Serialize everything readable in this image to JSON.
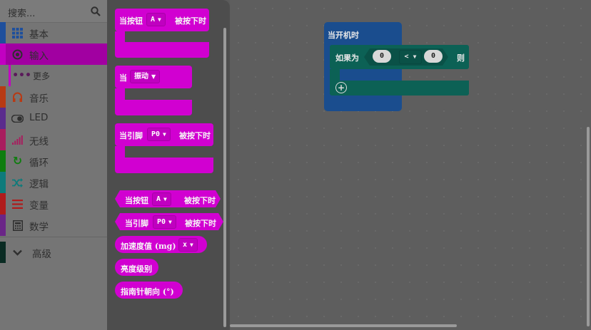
{
  "colors": {
    "basic": "#1e4f9c",
    "input": "#c200c2",
    "music": "#b83a14",
    "led": "#5a2b8d",
    "radio": "#a81d5e",
    "loops": "#0f7d0f",
    "logic": "#0e7b7b",
    "variables": "#b01c1c",
    "math": "#6a2587",
    "advanced": "#0a2b23",
    "flyout_block": "#d100d1",
    "logic_block": "#0c6155"
  },
  "search": {
    "placeholder": "搜索..."
  },
  "categories": [
    {
      "label": "基本",
      "icon": "grid-icon"
    },
    {
      "label": "输入",
      "icon": "radio-circle-icon"
    },
    {
      "label": "更多",
      "icon": "more-dots-icon"
    },
    {
      "label": "音乐",
      "icon": "headphones-icon"
    },
    {
      "label": "LED",
      "icon": "toggle-icon"
    },
    {
      "label": "无线",
      "icon": "signal-bars-icon"
    },
    {
      "label": "循环",
      "icon": "refresh-icon"
    },
    {
      "label": "逻辑",
      "icon": "shuffle-icon"
    },
    {
      "label": "变量",
      "icon": "list-lines-icon"
    },
    {
      "label": "数学",
      "icon": "calculator-icon"
    },
    {
      "label": "高级",
      "icon": "chevron-down-icon"
    }
  ],
  "flyout": {
    "on_button": {
      "prefix": "当按钮",
      "value": "A",
      "suffix": "被按下时"
    },
    "on_gesture": {
      "prefix": "当",
      "value": "振动"
    },
    "on_pin": {
      "prefix": "当引脚",
      "value": "P0",
      "suffix": "被按下时"
    },
    "button_pressed": {
      "prefix": "当按钮",
      "value": "A",
      "suffix": "被按下时"
    },
    "pin_pressed": {
      "prefix": "当引脚",
      "value": "P0",
      "suffix": "被按下时"
    },
    "acceleration": {
      "label": "加速度值 (mg)",
      "value": "x"
    },
    "light_level": {
      "label": "亮度级别"
    },
    "compass": {
      "label": "指南针朝向 (°)"
    }
  },
  "workspace": {
    "start_label": "当开机时",
    "if_label": "如果为",
    "left_value": "0",
    "operator": "<",
    "right_value": "0",
    "then_label": "则"
  }
}
